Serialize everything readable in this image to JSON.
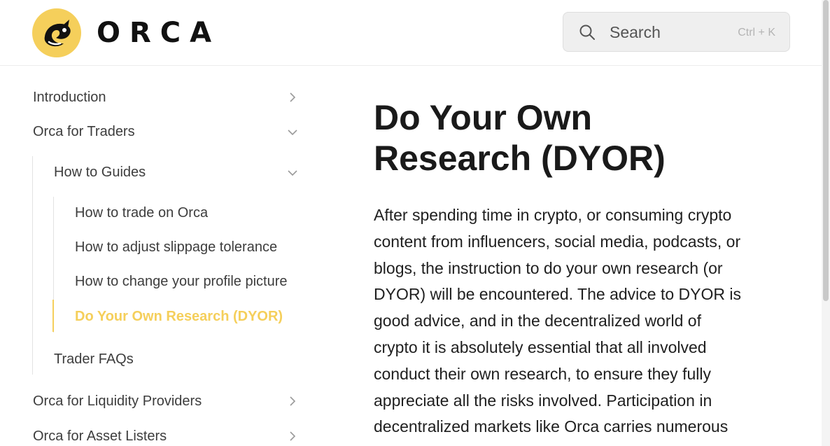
{
  "header": {
    "brand": "ORCA",
    "brand_color": "#f5cf5b",
    "logo_icon": "orca-logo-icon",
    "search": {
      "placeholder": "Search",
      "shortcut": "Ctrl + K",
      "icon": "search-icon"
    }
  },
  "sidebar": {
    "accent_color": "#f5cf5b",
    "items": [
      {
        "label": "Introduction",
        "icon": "chevron-right-icon"
      },
      {
        "label": "Orca for Traders",
        "icon": "chevron-down-icon"
      },
      {
        "label": "How to Guides",
        "icon": "chevron-down-icon"
      },
      {
        "label": "How to trade on Orca"
      },
      {
        "label": "How to adjust slippage tolerance"
      },
      {
        "label": "How to change your profile picture"
      },
      {
        "label": "Do Your Own Research (DYOR)",
        "active": true
      },
      {
        "label": "Trader FAQs"
      },
      {
        "label": "Orca for Liquidity Providers",
        "icon": "chevron-right-icon"
      },
      {
        "label": "Orca for Asset Listers",
        "icon": "chevron-right-icon"
      }
    ]
  },
  "main": {
    "title": "Do Your Own Research (DYOR)",
    "body": "After spending time in crypto, or consuming crypto content from influencers, social media, podcasts, or blogs, the instruction to do your own research (or DYOR) will be encountered. The advice to DYOR is good advice, and in the decentralized world of crypto it is absolutely essential that all involved conduct their own research, to ensure they fully appreciate all the risks involved.  Participation in decentralized markets like Orca carries numerous"
  }
}
